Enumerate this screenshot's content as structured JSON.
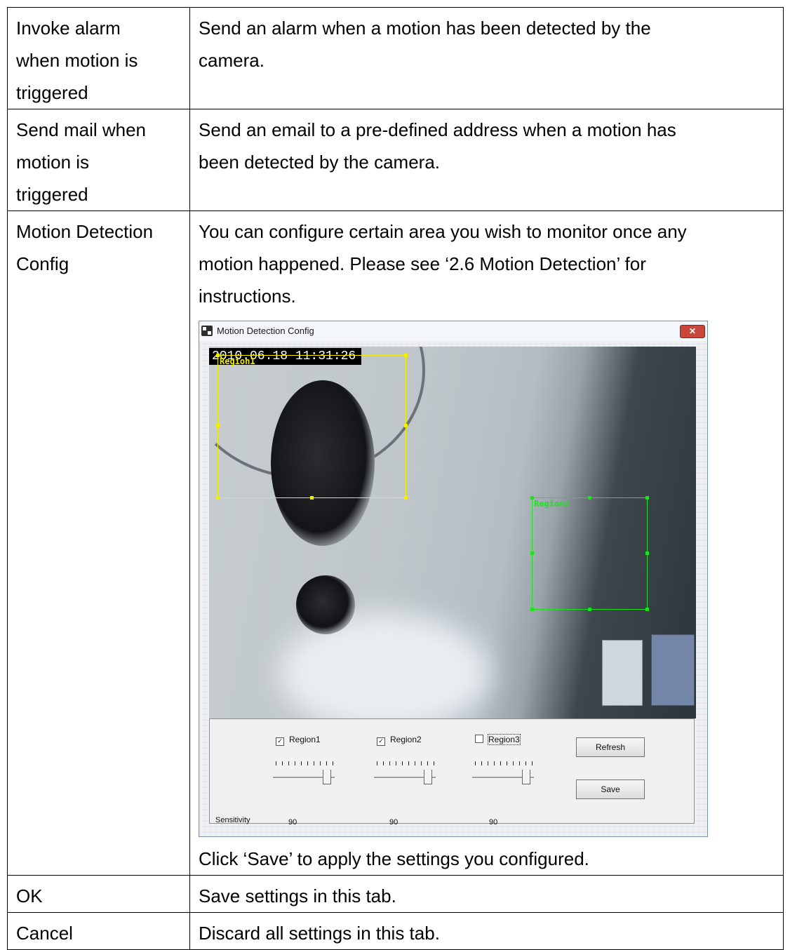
{
  "rows": [
    {
      "name_lines": [
        "Invoke alarm",
        "when motion is",
        "triggered"
      ],
      "desc_lines": [
        "Send an alarm when a motion has been detected by the",
        "camera."
      ]
    },
    {
      "name_lines": [
        "Send mail when",
        "motion is",
        "triggered"
      ],
      "desc_lines": [
        "Send an email to a pre-defined address when a motion has",
        "been detected by the camera."
      ]
    },
    {
      "name_lines": [
        "Motion Detection",
        "Config"
      ],
      "desc_lines": [
        "You can configure certain area you wish to monitor once any",
        "motion happened. Please see ‘2.6 Motion Detection’ for",
        "instructions."
      ],
      "after_figure": "Click ‘Save’ to apply the settings you configured."
    },
    {
      "name": "OK",
      "desc": "Save settings in this tab."
    },
    {
      "name": "Cancel",
      "desc": "Discard all settings in this tab."
    }
  ],
  "dialog": {
    "title": "Motion Detection Config",
    "close_glyph": "✕",
    "app_icon": "camera-app-icon",
    "timestamp": "2010.06.18 11:31:26",
    "regions": [
      {
        "label": "Region1",
        "color": "#f2f000"
      },
      {
        "label": "Region2",
        "color": "#21e021"
      }
    ],
    "controls": [
      {
        "label": "Region1",
        "checked": true,
        "check_glyph": "✓",
        "sensitivity": "90"
      },
      {
        "label": "Region2",
        "checked": true,
        "check_glyph": "✓",
        "sensitivity": "90"
      },
      {
        "label": "Region3",
        "checked": false,
        "check_glyph": "",
        "sensitivity": "90"
      }
    ],
    "sensitivity_label": "Sensitivity",
    "refresh_label": "Refresh",
    "save_label": "Save"
  }
}
